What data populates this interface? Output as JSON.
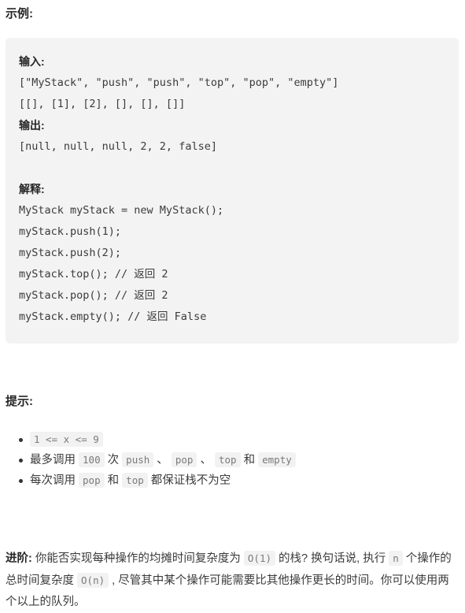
{
  "example": {
    "heading": "示例:",
    "code_lines": [
      {
        "type": "label",
        "text": "输入:"
      },
      {
        "type": "code",
        "text": "[\"MyStack\", \"push\", \"push\", \"top\", \"pop\", \"empty\"]"
      },
      {
        "type": "code",
        "text": "[[], [1], [2], [], [], []]"
      },
      {
        "type": "label",
        "text": "输出:"
      },
      {
        "type": "code",
        "text": "[null, null, null, 2, 2, false]"
      },
      {
        "type": "blank",
        "text": ""
      },
      {
        "type": "label",
        "text": "解释:"
      },
      {
        "type": "code",
        "text": "MyStack myStack = new MyStack();"
      },
      {
        "type": "code",
        "text": "myStack.push(1);"
      },
      {
        "type": "code",
        "text": "myStack.push(2);"
      },
      {
        "type": "code",
        "text": "myStack.top(); // 返回 2"
      },
      {
        "type": "code",
        "text": "myStack.pop(); // 返回 2"
      },
      {
        "type": "code",
        "text": "myStack.empty(); // 返回 False"
      }
    ]
  },
  "hints": {
    "heading": "提示:",
    "items": [
      {
        "parts": [
          {
            "kind": "code",
            "text": "1 <= x <= 9"
          }
        ]
      },
      {
        "parts": [
          {
            "kind": "text",
            "text": "最多调用 "
          },
          {
            "kind": "code",
            "text": "100"
          },
          {
            "kind": "text",
            "text": " 次 "
          },
          {
            "kind": "code",
            "text": "push"
          },
          {
            "kind": "text",
            "text": " 、 "
          },
          {
            "kind": "code",
            "text": "pop"
          },
          {
            "kind": "text",
            "text": " 、 "
          },
          {
            "kind": "code",
            "text": "top"
          },
          {
            "kind": "text",
            "text": " 和 "
          },
          {
            "kind": "code",
            "text": "empty"
          }
        ]
      },
      {
        "parts": [
          {
            "kind": "text",
            "text": "每次调用 "
          },
          {
            "kind": "code",
            "text": "pop"
          },
          {
            "kind": "text",
            "text": " 和 "
          },
          {
            "kind": "code",
            "text": "top"
          },
          {
            "kind": "text",
            "text": " 都保证栈不为空"
          }
        ]
      }
    ]
  },
  "advanced": {
    "label": "进阶:",
    "parts": [
      {
        "kind": "text",
        "text": " 你能否实现每种操作的均摊时间复杂度为 "
      },
      {
        "kind": "code",
        "text": "O(1)"
      },
      {
        "kind": "text",
        "text": " 的栈? 换句话说, 执行 "
      },
      {
        "kind": "code",
        "text": "n"
      },
      {
        "kind": "text",
        "text": " 个操作的总时间复杂度 "
      },
      {
        "kind": "code",
        "text": "O(n)"
      },
      {
        "kind": "text",
        "text": " , 尽管其中某个操作可能需要比其他操作更长的时间。你可以使用两个以上的队列。"
      }
    ]
  },
  "colors": {
    "page_background": "#ffffff",
    "code_block_background": "#f3f3f3",
    "inline_code_background": "#f2f2f2",
    "inline_code_text": "#7a7a7a",
    "body_text": "#3b3b3b",
    "heading_text": "#262626"
  }
}
